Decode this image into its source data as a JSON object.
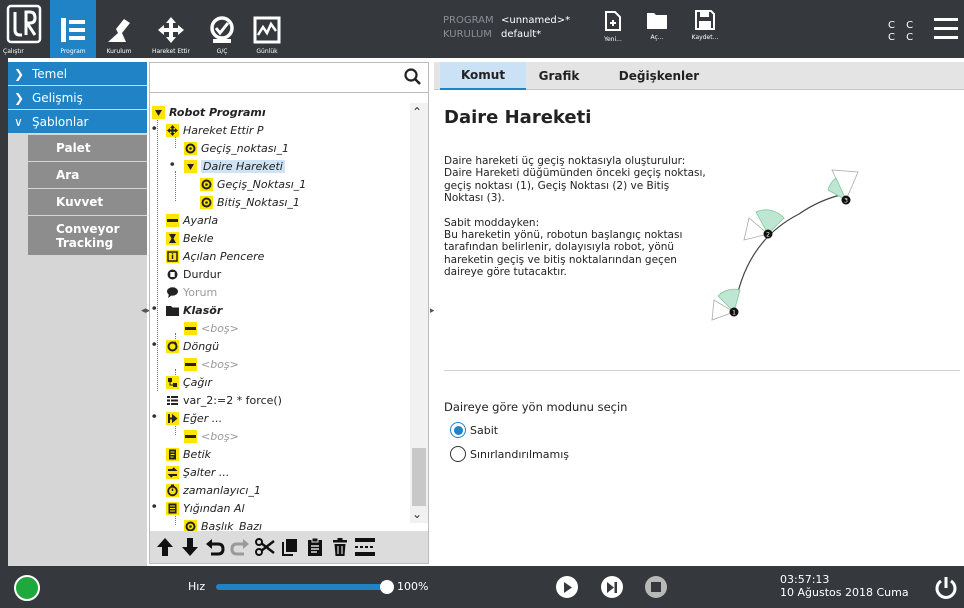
{
  "header": {
    "logo_label": "Çalıştır",
    "nav": [
      {
        "label": "Program",
        "icon": "program-icon",
        "active": true
      },
      {
        "label": "Kurulum",
        "icon": "installation-icon"
      },
      {
        "label": "Hareket Ettir",
        "icon": "move-icon"
      },
      {
        "label": "G/Ç",
        "icon": "io-icon"
      },
      {
        "label": "Günlük",
        "icon": "log-icon"
      }
    ],
    "program_key": "PROGRAM",
    "program_value": "<unnamed>*",
    "installation_key": "KURULUM",
    "installation_value": "default*",
    "file_buttons": {
      "new": "Yeni...",
      "open": "Aç...",
      "save": "Kaydet..."
    },
    "cc_top": "C C",
    "cc_bottom": "C C"
  },
  "categories": {
    "basic": "Temel",
    "advanced": "Gelişmiş",
    "templates": "Şablonlar",
    "template_items": [
      "Palet",
      "Ara",
      "Kuvvet",
      "Conveyor Tracking"
    ]
  },
  "tree": {
    "root": "Robot Programı",
    "items": [
      "Hareket Ettir P",
      "Geçiş_noktası_1",
      "Daire Hareketi",
      "Geçiş_Noktası_1",
      "Bitiş_Noktası_1",
      "Ayarla",
      "Bekle",
      "Açılan Pencere",
      "Durdur",
      "Yorum",
      "Klasör",
      "<boş>",
      "Döngü",
      "<boş>",
      "Çağır",
      "var_2:=2 * force()",
      "Eğer ...",
      "<boş>",
      "Betik",
      "Şalter ...",
      "zamanlayıcı_1",
      "Yığından Al",
      "Başlık_Bazı"
    ]
  },
  "tabs": [
    "Komut",
    "Grafik",
    "Değişkenler"
  ],
  "command": {
    "title": "Daire Hareketi",
    "paragraph1": "Daire hareketi üç geçiş noktasıyla oluşturulur: Daire Hareketi düğümünden önceki geçiş noktası, geçiş noktası (1), Geçiş Noktası (2) ve Bitiş Noktası (3).",
    "paragraph2_title": "Sabit moddayken:",
    "paragraph2": "Bu hareketin yönü, robotun başlangıç noktası tarafından belirlenir, dolayısıyla robot, yönü hareketin geçiş ve bitiş noktalarından geçen daireye göre tutacaktır.",
    "diagram_labels": [
      "1",
      "2",
      "3"
    ],
    "mode_label": "Daireye göre yön modunu seçin",
    "mode_options": [
      "Sabit",
      "Sınırlandırılmamış"
    ],
    "mode_selected": "Sabit"
  },
  "footer": {
    "speed_label": "Hız",
    "speed_value": "100%",
    "speed_fraction": 1.0,
    "time": "03:57:13",
    "date": "10 Ağustos 2018 Cuma"
  },
  "colors": {
    "accent": "#1f83c6",
    "header_bg": "#35393e",
    "node_yellow": "#ffe500",
    "power_green": "#1fa83c"
  }
}
